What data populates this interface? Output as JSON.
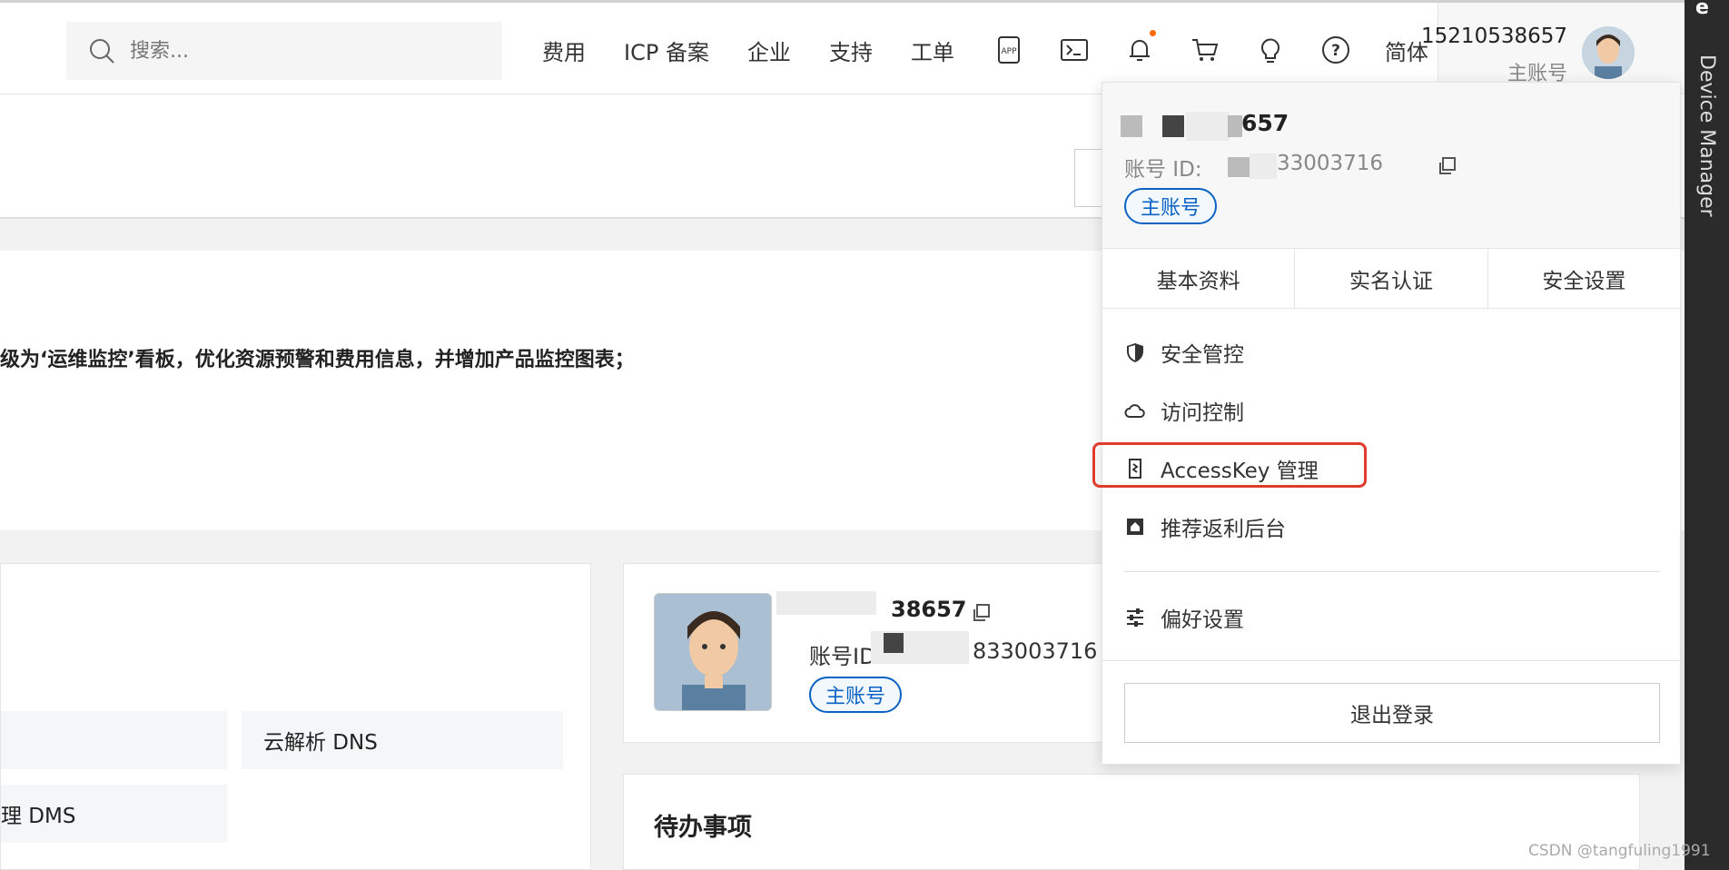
{
  "header": {
    "search_placeholder": "搜索...",
    "nav": [
      "费用",
      "ICP 备案",
      "企业",
      "支持",
      "工单"
    ],
    "icons": [
      "app-icon",
      "terminal-icon",
      "bell-icon",
      "cart-icon",
      "lightbulb-icon",
      "help-icon"
    ],
    "lang": "简体",
    "user_name": "15210538657",
    "user_role": "主账号"
  },
  "rail": {
    "top_text": "e",
    "label": "Device Manager"
  },
  "notice": {
    "text": "级为‘运维监控’看板，优化资源预警和费用信息，并增加产品监控图表；"
  },
  "tiles": {
    "dns": "云解析 DNS",
    "dms": "理 DMS"
  },
  "profile": {
    "name": "38657",
    "id_label": "账号ID",
    "id": "833003716",
    "badge": "主账号"
  },
  "todo": {
    "title": "待办事项"
  },
  "dropdown": {
    "name": "657",
    "id_label": "账号 ID:",
    "id": "33003716",
    "badge": "主账号",
    "tabs": [
      "基本资料",
      "实名认证",
      "安全设置"
    ],
    "items": [
      {
        "label": "安全管控",
        "icon": "shield-icon"
      },
      {
        "label": "访问控制",
        "icon": "cloud-icon"
      },
      {
        "label": "AccessKey 管理",
        "icon": "key-icon"
      },
      {
        "label": "推荐返利后台",
        "icon": "rebate-icon"
      },
      {
        "label": "偏好设置",
        "icon": "sliders-icon"
      }
    ],
    "logout": "退出登录"
  },
  "watermark": "CSDN @tangfuling1991",
  "colors": {
    "accent": "#0a62c4",
    "highlight": "#e03c2d",
    "dot": "#ff6a00"
  }
}
